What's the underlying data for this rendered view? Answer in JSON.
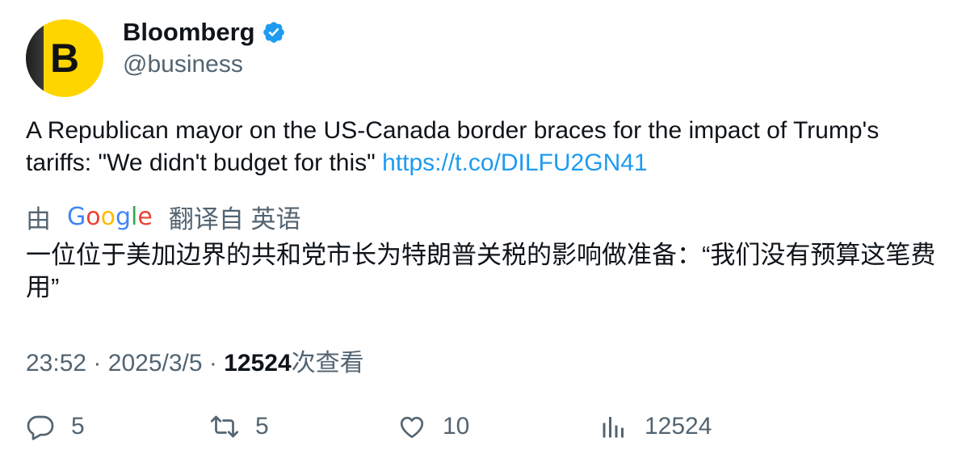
{
  "author": {
    "avatar_letter": "B",
    "name": "Bloomberg",
    "handle": "@business",
    "verified_icon": "verified-badge-icon",
    "accent": "#1d9bf0"
  },
  "tweet": {
    "text": "A Republican mayor on the US-Canada border braces for the impact of Trump's tariffs: \"We didn't budget for this\" ",
    "link": "https://t.co/DILFU2GN41"
  },
  "translation": {
    "prefix": "由",
    "google": [
      "G",
      "o",
      "o",
      "g",
      "l",
      "e"
    ],
    "suffix": "翻译自 英语",
    "text": "一位位于美加边界的共和党市长为特朗普关税的影响做准备：“我们没有预算这笔费用”"
  },
  "meta": {
    "time": "23:52",
    "separator": "·",
    "date": "2025/3/5",
    "views": "12524",
    "views_label": "次查看"
  },
  "actions": {
    "replies": "5",
    "retweets": "5",
    "likes": "10",
    "views": "12524"
  }
}
